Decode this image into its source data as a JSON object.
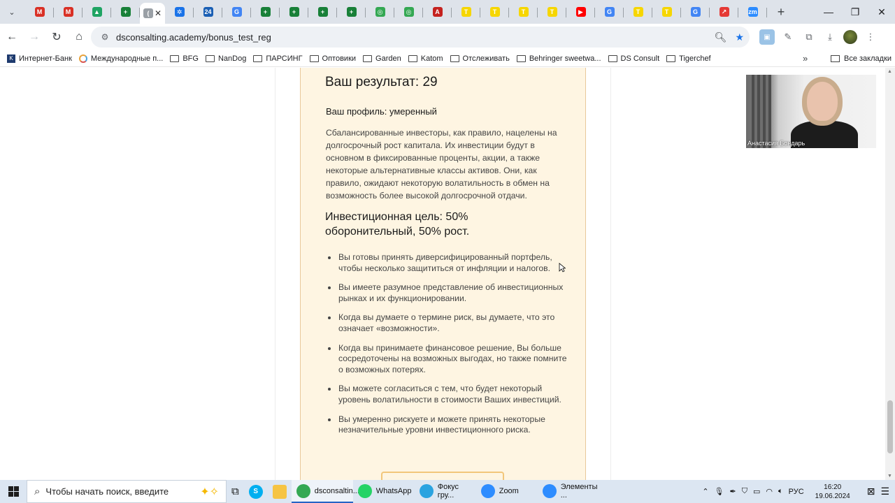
{
  "browser": {
    "tabs": [
      {
        "favicon": "gmail-icon",
        "color": "#d93025",
        "letter": "M"
      },
      {
        "favicon": "gmail-icon",
        "color": "#d93025",
        "letter": "M"
      },
      {
        "favicon": "drive-icon",
        "color": "#1fa463",
        "letter": "▲"
      },
      {
        "favicon": "sheets-icon",
        "color": "#188038",
        "letter": "+"
      },
      {
        "favicon": "page-icon",
        "color": "#9aa0a6",
        "letter": "(",
        "active": true
      },
      {
        "favicon": "gear-site-icon",
        "color": "#1a73e8",
        "letter": "✲"
      },
      {
        "favicon": "number-24-icon",
        "color": "#1a5fb4",
        "letter": "24"
      },
      {
        "favicon": "translate-icon",
        "color": "#4285f4",
        "letter": "G"
      },
      {
        "favicon": "sheets-icon",
        "color": "#188038",
        "letter": "+"
      },
      {
        "favicon": "sheets-icon",
        "color": "#188038",
        "letter": "+"
      },
      {
        "favicon": "sheets-icon",
        "color": "#188038",
        "letter": "+"
      },
      {
        "favicon": "sheets-icon",
        "color": "#188038",
        "letter": "+"
      },
      {
        "favicon": "globe-icon",
        "color": "#34a853",
        "letter": "◎"
      },
      {
        "favicon": "globe-icon",
        "color": "#34a853",
        "letter": "◎"
      },
      {
        "favicon": "az-icon",
        "color": "#c5221f",
        "letter": "A"
      },
      {
        "favicon": "yellow-t-icon",
        "color": "#f6d600",
        "letter": "T"
      },
      {
        "favicon": "yellow-t-icon",
        "color": "#f6d600",
        "letter": "T"
      },
      {
        "favicon": "yellow-t-icon",
        "color": "#f6d600",
        "letter": "T"
      },
      {
        "favicon": "yellow-t-icon",
        "color": "#f6d600",
        "letter": "T"
      },
      {
        "favicon": "youtube-icon",
        "color": "#ff0000",
        "letter": "▶"
      },
      {
        "favicon": "google-icon",
        "color": "#4285f4",
        "letter": "G"
      },
      {
        "favicon": "yellow-t-icon",
        "color": "#f6d600",
        "letter": "T"
      },
      {
        "favicon": "yellow-t-icon",
        "color": "#f6d600",
        "letter": "T"
      },
      {
        "favicon": "google-icon",
        "color": "#4285f4",
        "letter": "G"
      },
      {
        "favicon": "chart-icon",
        "color": "#e53935",
        "letter": "↗"
      },
      {
        "favicon": "zoom-icon",
        "color": "#2d8cff",
        "letter": "zm"
      }
    ],
    "url": "dsconsalting.academy/bonus_test_reg",
    "bookmarks": [
      {
        "label": "Интернет-Банк",
        "icon": "k-bank-icon"
      },
      {
        "label": "Международные п...",
        "icon": "ring-icon"
      },
      {
        "label": "BFG",
        "icon": "folder-icon"
      },
      {
        "label": "NanDog",
        "icon": "folder-icon"
      },
      {
        "label": "ПАРСИНГ",
        "icon": "folder-icon"
      },
      {
        "label": "Оптовики",
        "icon": "folder-icon"
      },
      {
        "label": "Garden",
        "icon": "folder-icon"
      },
      {
        "label": "Katom",
        "icon": "folder-icon"
      },
      {
        "label": "Отслеживать",
        "icon": "folder-icon"
      },
      {
        "label": "Behringer sweetwa...",
        "icon": "folder-icon"
      },
      {
        "label": "DS Consult",
        "icon": "folder-icon"
      },
      {
        "label": "Tigerchef",
        "icon": "folder-icon"
      }
    ],
    "all_bookmarks": "Все закладки",
    "more_glyph": "»",
    "newtab_glyph": "+"
  },
  "page": {
    "result_title": "Ваш результат: 29",
    "profile": "Ваш профиль: умеренный",
    "description": "Сбалансированные инвесторы, как правило, нацелены на долгосрочный рост капитала. Их инвестиции будут в основном в фиксированные проценты, акции, а также некоторые альтернативные классы активов. Они, как правило, ожидают некоторую волатильность в обмен на возможность более высокой долгосрочной отдачи.",
    "goal": "Инвестиционная цель: 50% оборонительный, 50% рост.",
    "bullets": [
      "Вы готовы принять диверсифицированный портфель, чтобы несколько защититься от инфляции и налогов.",
      "Вы имеете разумное представление об инвестиционных рынках и их функционировании.",
      "Когда вы думаете о термине риск, вы думаете, что это означает «возможности».",
      "Когда вы принимаете финансовое решение, Вы больше сосредоточены на возможных выгодах, но также помните о возможных потерях.",
      "Вы можете согласиться с тем, что будет некоторый уровень волатильности в стоимости Ваших инвестиций.",
      "Вы умеренно рискуете и можете принять некоторые незначительные уровни инвестиционного риска."
    ]
  },
  "video": {
    "participant_name": "Анастасия Бондарь"
  },
  "taskbar": {
    "search_placeholder": "Чтобы начать поиск, введите",
    "apps": [
      {
        "label": "dsconsaltin...",
        "icon": "chrome-icon",
        "color": "#34a853",
        "active": true
      },
      {
        "label": "WhatsApp",
        "icon": "whatsapp-icon",
        "color": "#25d366"
      },
      {
        "label": "Фокус гру...",
        "icon": "telegram-icon",
        "color": "#2aa3e0"
      },
      {
        "label": "Zoom",
        "icon": "zoom-icon",
        "color": "#2d8cff"
      },
      {
        "label": "Элементы ...",
        "icon": "zoom-icon",
        "color": "#2d8cff"
      }
    ],
    "language": "РУС",
    "time": "16:20",
    "date": "19.06.2024"
  },
  "colors": {
    "card_bg": "#fef5e2",
    "card_border": "#e8c89a",
    "accent": "#1a73e8"
  }
}
